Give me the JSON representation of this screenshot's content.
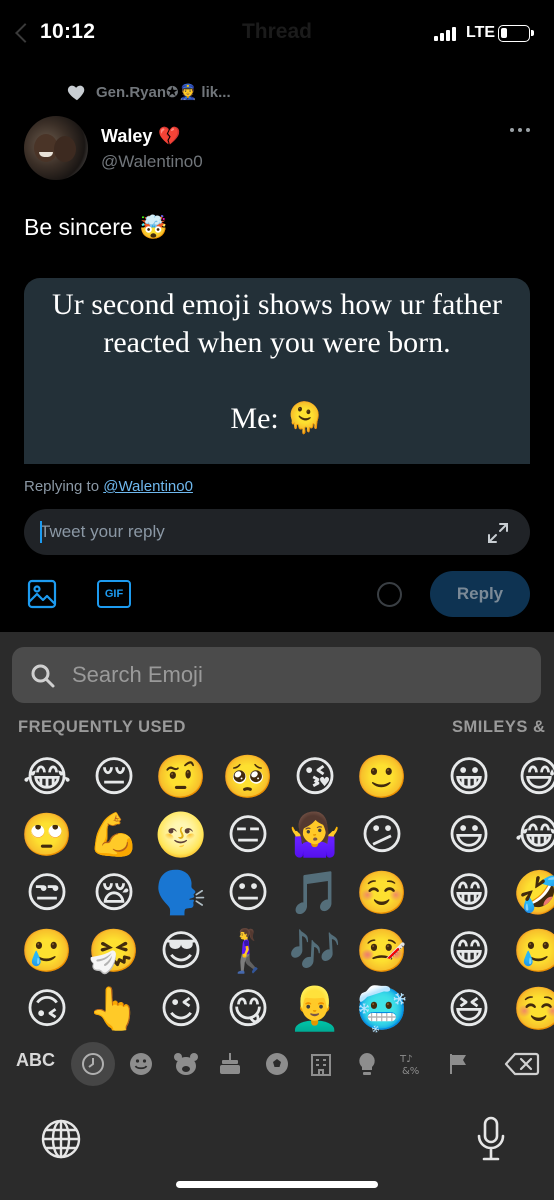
{
  "status_bar": {
    "time": "10:12",
    "network": "LTE",
    "nav_title": "Thread"
  },
  "tweet": {
    "social_context": "Gen.Ryan✪👮 lik...",
    "author_name": "Waley",
    "author_emoji": "💔",
    "author_handle": "@Walentino0",
    "text": "Be sincere 🤯",
    "quote_text": "Ur second emoji shows how ur father reacted when you were born.\n\nMe: 🫠"
  },
  "reply": {
    "replying_prefix": "Replying to",
    "replying_handle": "@Walentino0",
    "input_placeholder": "Tweet your reply",
    "gif_label": "GIF",
    "reply_button_label": "Reply"
  },
  "keyboard": {
    "search_placeholder": "Search Emoji",
    "section_frequently_used": "FREQUENTLY USED",
    "section_smileys": "SMILEYS &",
    "abc_label": "ABC",
    "emoji_rows": [
      [
        "😂",
        "😔",
        "🤨",
        "🥺",
        "😘",
        "🙂",
        "😀",
        "😅"
      ],
      [
        "🙄",
        "💪",
        "🌝",
        "😑",
        "🤷‍♀️",
        "😕",
        "😃",
        "😂"
      ],
      [
        "😒",
        "😪",
        "🗣️",
        "😐",
        "🎵",
        "☺️",
        "😁",
        "🤣"
      ],
      [
        "🥲",
        "🤧",
        "😎",
        "🚶‍♀️",
        "🎶",
        "🤒",
        "😁",
        "🥲"
      ],
      [
        "🙃",
        "👆",
        "😉",
        "😋",
        "👱‍♂️",
        "🥶",
        "😆",
        "☺️"
      ]
    ],
    "category_icons": [
      "clock-icon",
      "smiley-icon",
      "bear-icon",
      "food-icon",
      "ball-icon",
      "building-icon",
      "bulb-icon",
      "symbols-icon",
      "flag-icon",
      "delete-icon"
    ]
  }
}
